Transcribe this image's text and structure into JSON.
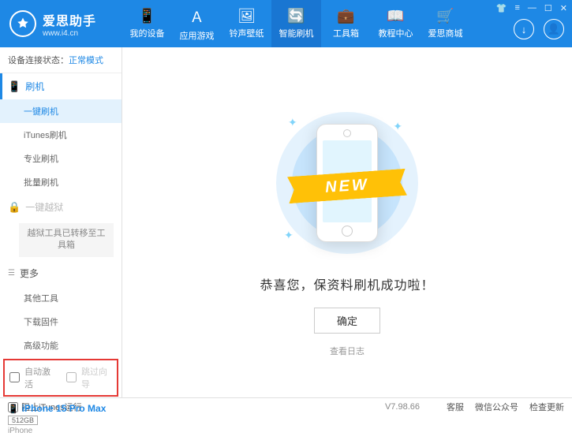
{
  "header": {
    "logo_title": "爱思助手",
    "logo_url": "www.i4.cn",
    "nav": [
      {
        "label": "我的设备"
      },
      {
        "label": "应用游戏"
      },
      {
        "label": "铃声壁纸"
      },
      {
        "label": "智能刷机"
      },
      {
        "label": "工具箱"
      },
      {
        "label": "教程中心"
      },
      {
        "label": "爱思商城"
      }
    ]
  },
  "sidebar": {
    "status_label": "设备连接状态：",
    "status_mode": "正常模式",
    "flash_header": "刷机",
    "flash_items": [
      "一键刷机",
      "iTunes刷机",
      "专业刷机",
      "批量刷机"
    ],
    "jailbreak_header": "一键越狱",
    "jailbreak_note": "越狱工具已转移至工具箱",
    "more_header": "更多",
    "more_items": [
      "其他工具",
      "下载固件",
      "高级功能"
    ],
    "checkbox1": "自动激活",
    "checkbox2": "跳过向导",
    "device_name": "iPhone 15 Pro Max",
    "device_storage": "512GB",
    "device_model": "iPhone"
  },
  "main": {
    "ribbon": "NEW",
    "success": "恭喜您，保资料刷机成功啦！",
    "ok": "确定",
    "view_log": "查看日志"
  },
  "footer": {
    "block_itunes": "阻止iTunes运行",
    "version": "V7.98.66",
    "links": [
      "客服",
      "微信公众号",
      "检查更新"
    ]
  }
}
